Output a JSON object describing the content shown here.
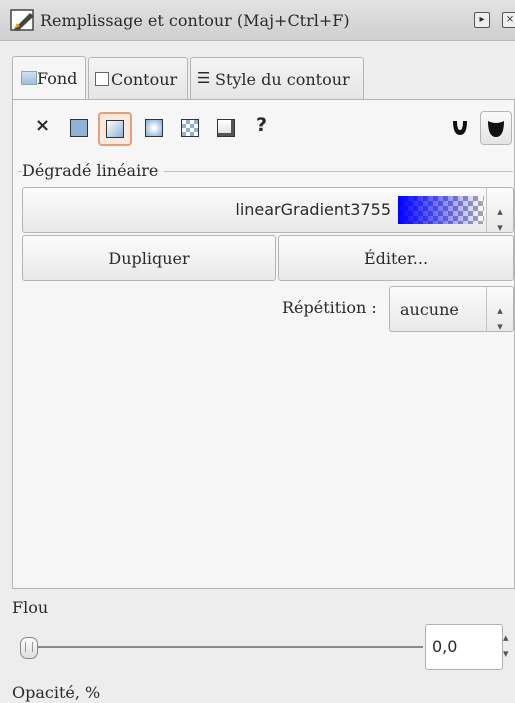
{
  "title": "Remplissage et contour (Maj+Ctrl+F)",
  "tabs": [
    {
      "label": "Fond"
    },
    {
      "label": "Contour"
    },
    {
      "label": "Style du contour"
    }
  ],
  "fill_modes": [
    "none",
    "flat-color",
    "linear-gradient",
    "radial-gradient",
    "pattern",
    "swatch",
    "unset"
  ],
  "selected_fill_mode": "linear-gradient",
  "gradient_section": {
    "label": "Dégradé linéaire",
    "gradient_name": "linearGradient3755",
    "gradient_color": "#0000ff",
    "duplicate_label": "Dupliquer",
    "edit_label": "Éditer...",
    "repeat_label": "Répétition :",
    "repeat_value": "aucune"
  },
  "blur": {
    "label": "Flou",
    "value": "0,0",
    "slider_fraction": 0
  },
  "opacity": {
    "label": "Opacité, %"
  },
  "colors": {
    "active_mode_border": "#e0a07a",
    "gradient_blue": "#0000ff"
  }
}
